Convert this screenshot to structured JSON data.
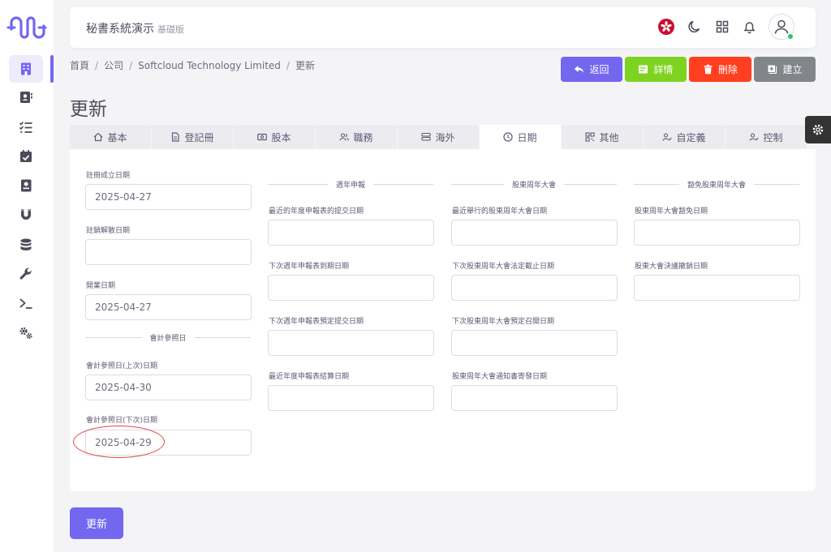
{
  "header": {
    "title": "秘書系統演示",
    "subtitle": "基礎版"
  },
  "breadcrumb": [
    "首頁",
    "公司",
    "Softcloud Technology Limited",
    "更新"
  ],
  "actions": {
    "back": "返回",
    "details": "詳情",
    "delete": "刪除",
    "create": "建立"
  },
  "page_title": "更新",
  "tabs": [
    "基本",
    "登記冊",
    "股本",
    "職務",
    "海外",
    "日期",
    "其他",
    "自定義",
    "控制"
  ],
  "fields": {
    "incorporation_date": {
      "label": "註冊成立日期",
      "value": "2025-04-27"
    },
    "deregistration_date": {
      "label": "註銷解散日期",
      "value": ""
    },
    "business_start_date": {
      "label": "開業日期",
      "value": "2025-04-27"
    },
    "accounting_section": "會計參照日",
    "accounting_prev": {
      "label": "會計參照日(上次)日期",
      "value": "2025-04-30"
    },
    "accounting_next": {
      "label": "會計參照日(下次)日期",
      "value": "2025-04-29"
    }
  },
  "annual_return": {
    "section": "週年申報",
    "latest_submission": {
      "label": "最近的年度申報表的提交日期",
      "value": ""
    },
    "next_due": {
      "label": "下次週年申報表到期日期",
      "value": ""
    },
    "next_planned_submission": {
      "label": "下次週年申報表預定提交日期",
      "value": ""
    },
    "latest_made_up": {
      "label": "最近年度申報表結算日期",
      "value": ""
    }
  },
  "agm": {
    "section": "股東周年大會",
    "latest_held": {
      "label": "最近舉行的股東周年大會日期",
      "value": ""
    },
    "next_statutory_deadline": {
      "label": "下次股東周年大會法定截止日期",
      "value": ""
    },
    "next_planned": {
      "label": "下次股東周年大會預定召開日期",
      "value": ""
    },
    "notice_sent": {
      "label": "股東周年大會通知書寄發日期",
      "value": ""
    }
  },
  "agm_exemption": {
    "section": "豁免股東周年大會",
    "exemption_date": {
      "label": "股東周年大會豁免日期",
      "value": ""
    },
    "resolution_revoked": {
      "label": "股東大會決議撤銷日期",
      "value": ""
    }
  },
  "submit_label": "更新",
  "colors": {
    "primary": "#7367f0",
    "success": "#7ed321",
    "danger": "#ff3f1f",
    "secondary": "#82868b",
    "annotation": "#e04545"
  }
}
